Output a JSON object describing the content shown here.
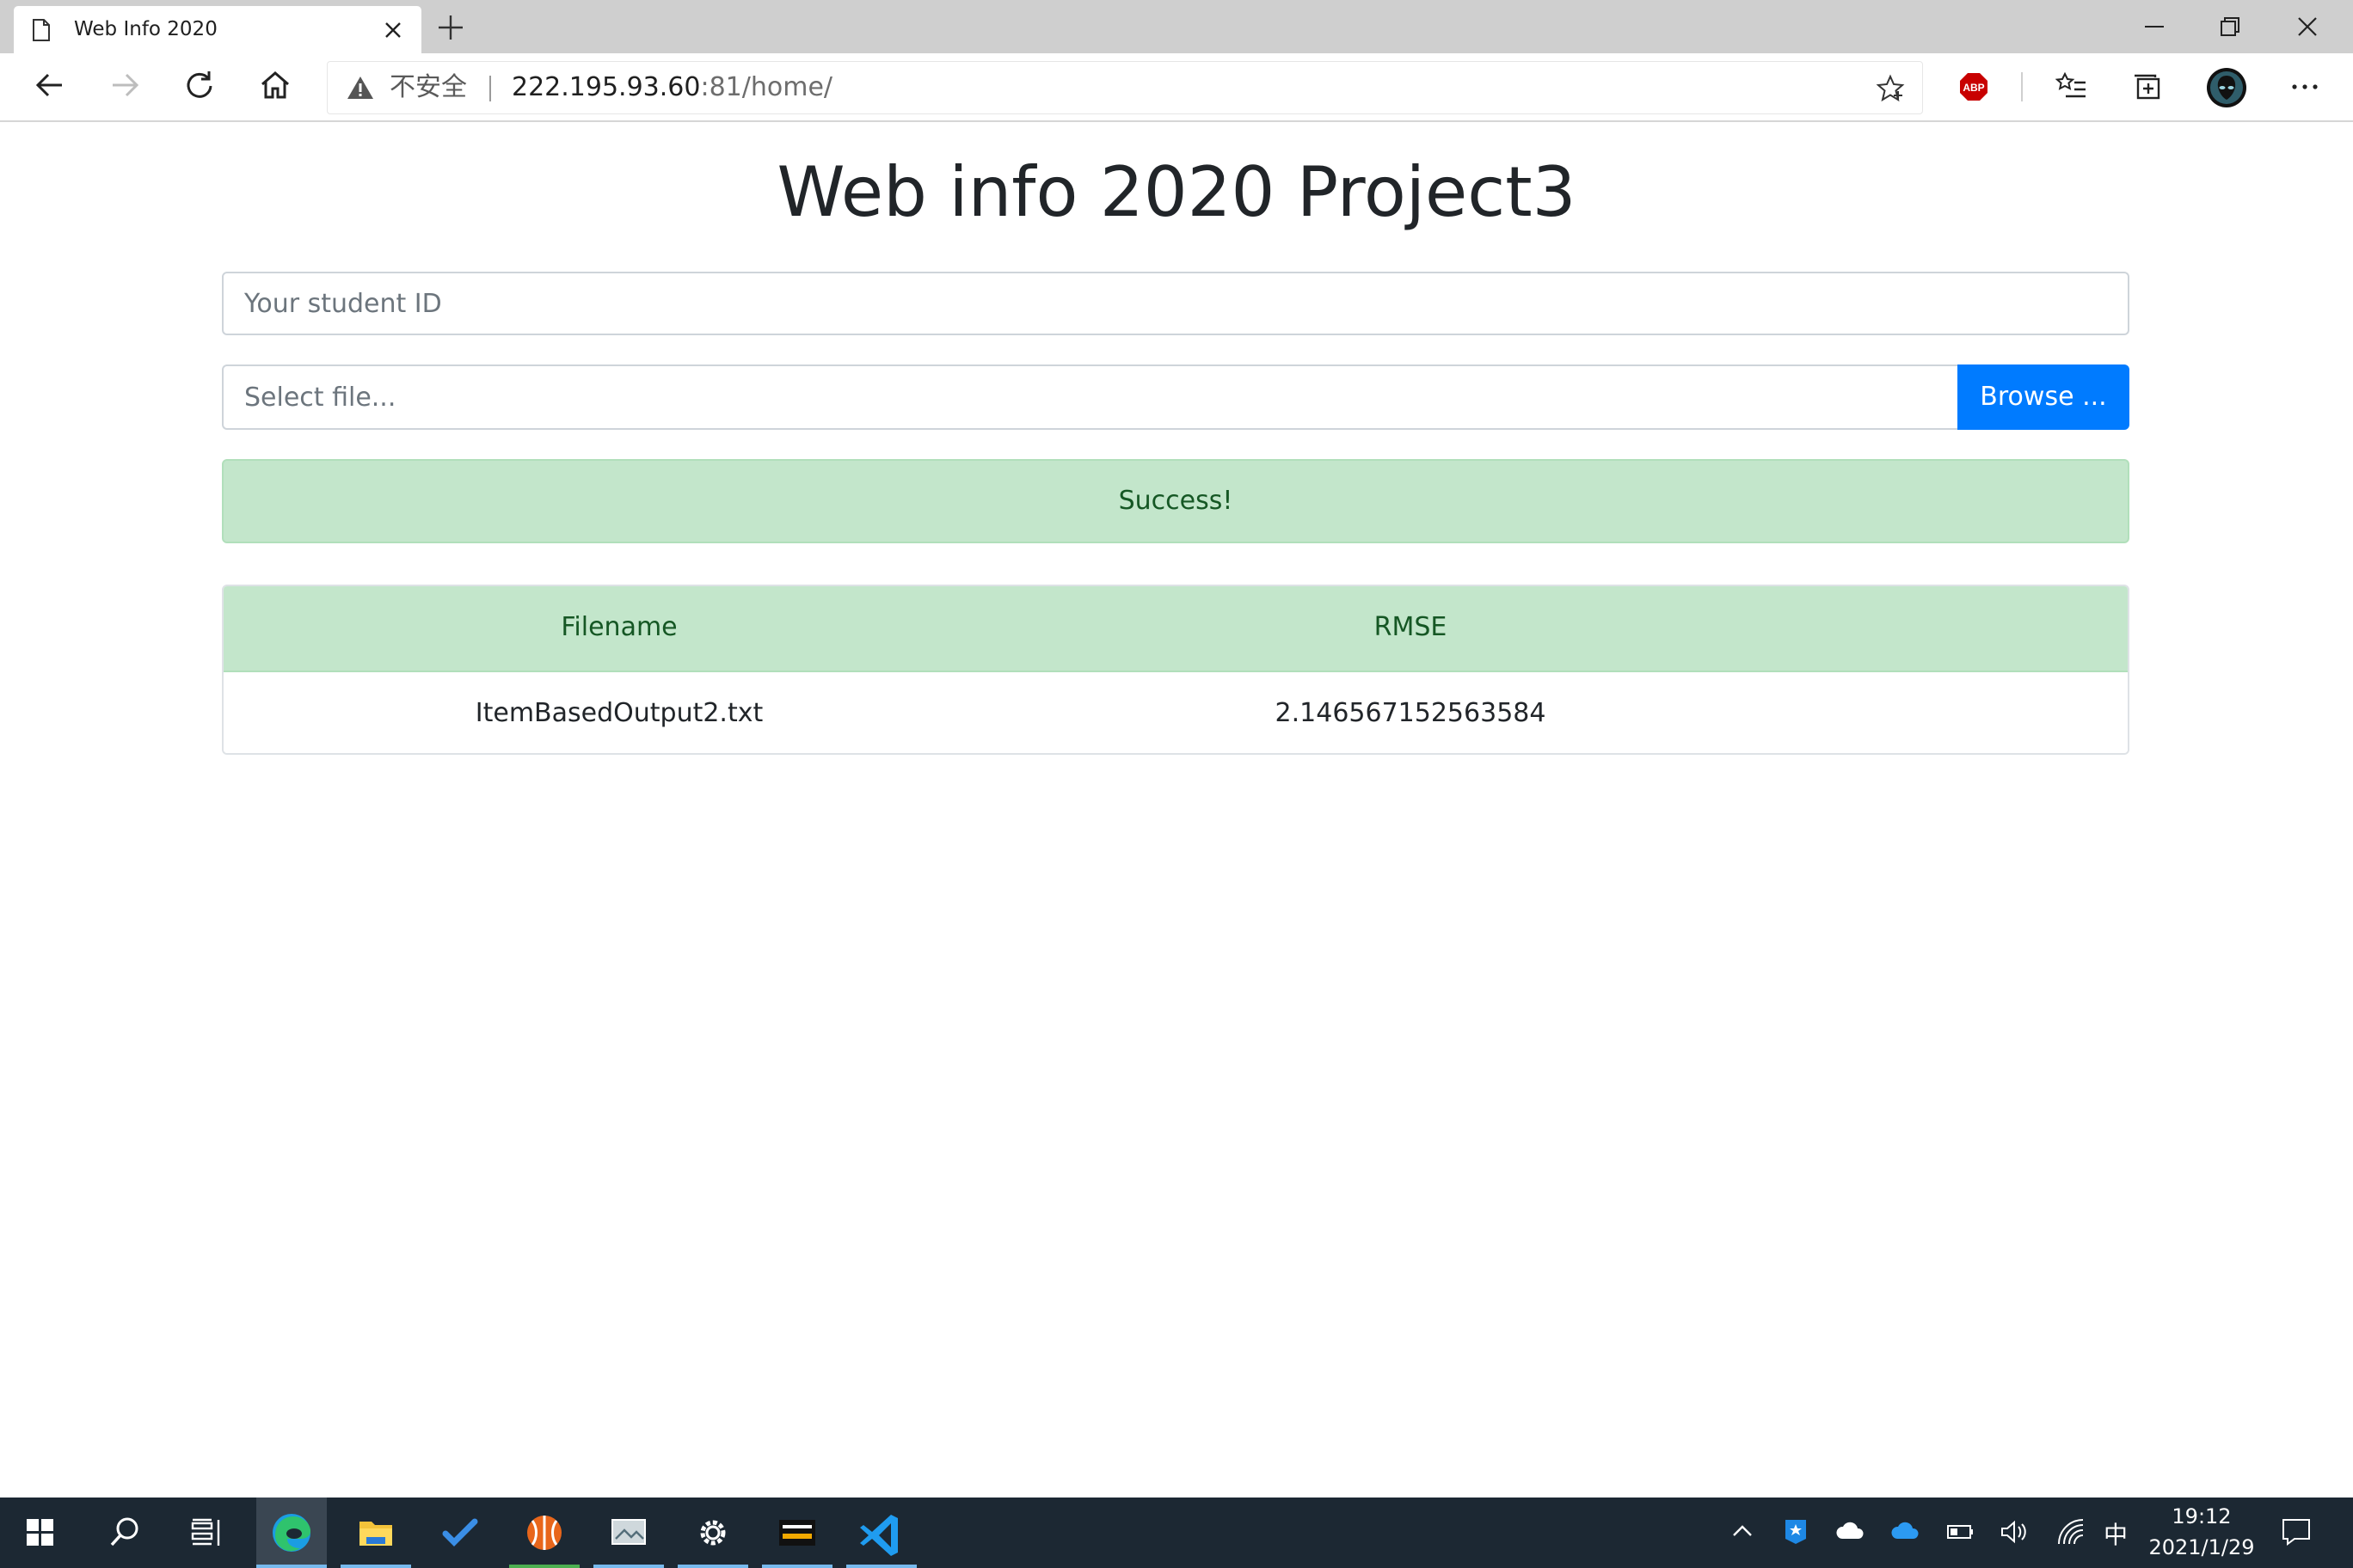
{
  "browser": {
    "tab_title": "Web Info 2020",
    "security_label": "不安全",
    "url_host": "222.195.93.60",
    "url_rest": ":81/home/",
    "abp_label": "ABP"
  },
  "page": {
    "title": "Web info 2020 Project3",
    "student_id_placeholder": "Your student ID",
    "file_placeholder": "Select file...",
    "browse_label": "Browse ...",
    "alert": "Success!",
    "table": {
      "headers": [
        "Filename",
        "RMSE"
      ],
      "rows": [
        [
          "ItemBasedOutput2.txt",
          "2.146567152563584"
        ]
      ]
    }
  },
  "taskbar": {
    "time": "19:12",
    "date": "2021/1/29",
    "ime": "中",
    "accent": "#76b9ed"
  },
  "colors": {
    "primary": "#007bff",
    "success_bg": "#c3e6cb",
    "success_text": "#155724",
    "taskbar_bg": "#1c2833"
  }
}
